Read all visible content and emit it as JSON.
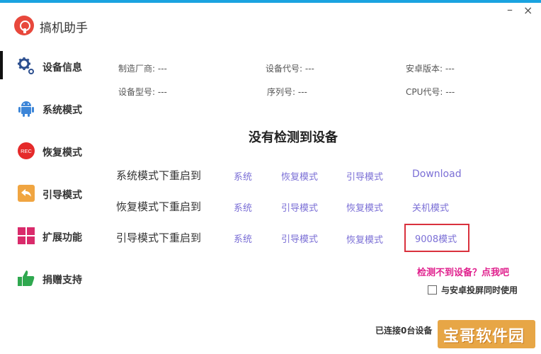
{
  "window": {
    "title": "搞机助手",
    "minimize_glyph": "–",
    "close_glyph": "×"
  },
  "sidebar": {
    "items": [
      {
        "label": "设备信息",
        "icon": "gear-icon",
        "active": true
      },
      {
        "label": "系统模式",
        "icon": "android-icon"
      },
      {
        "label": "恢复模式",
        "icon": "rec-icon",
        "icon_text": "REC"
      },
      {
        "label": "引导模式",
        "icon": "back-arrow-icon"
      },
      {
        "label": "扩展功能",
        "icon": "grid-icon"
      },
      {
        "label": "捐赠支持",
        "icon": "thumbs-up-icon"
      }
    ]
  },
  "device_info": {
    "manufacturer": "制造厂商: ---",
    "device_code": "设备代号: ---",
    "android_version": "安卓版本: ---",
    "model": "设备型号: ---",
    "serial": "序列号: ---",
    "cpu": "CPU代号: ---"
  },
  "status_heading": "没有检测到设备",
  "reboot_rows": [
    {
      "label": "系统模式下重启到",
      "options": [
        "系统",
        "恢复模式",
        "引导模式",
        "Download"
      ]
    },
    {
      "label": "恢复模式下重启到",
      "options": [
        "系统",
        "引导模式",
        "恢复模式",
        "关机模式"
      ]
    },
    {
      "label": "引导模式下重启到",
      "options": [
        "系统",
        "引导模式",
        "恢复模式",
        "9008模式"
      ]
    }
  ],
  "help_link": "检测不到设备？点我吧",
  "cast_checkbox": {
    "label": "与安卓投屏同时使用",
    "checked": false
  },
  "connection_status": "已连接0台设备",
  "watermark": "宝哥软件园",
  "colors": {
    "accent": "#1aa3e0",
    "link": "#7b6fd6",
    "help": "#e0208d",
    "highlight": "#d9313d"
  }
}
